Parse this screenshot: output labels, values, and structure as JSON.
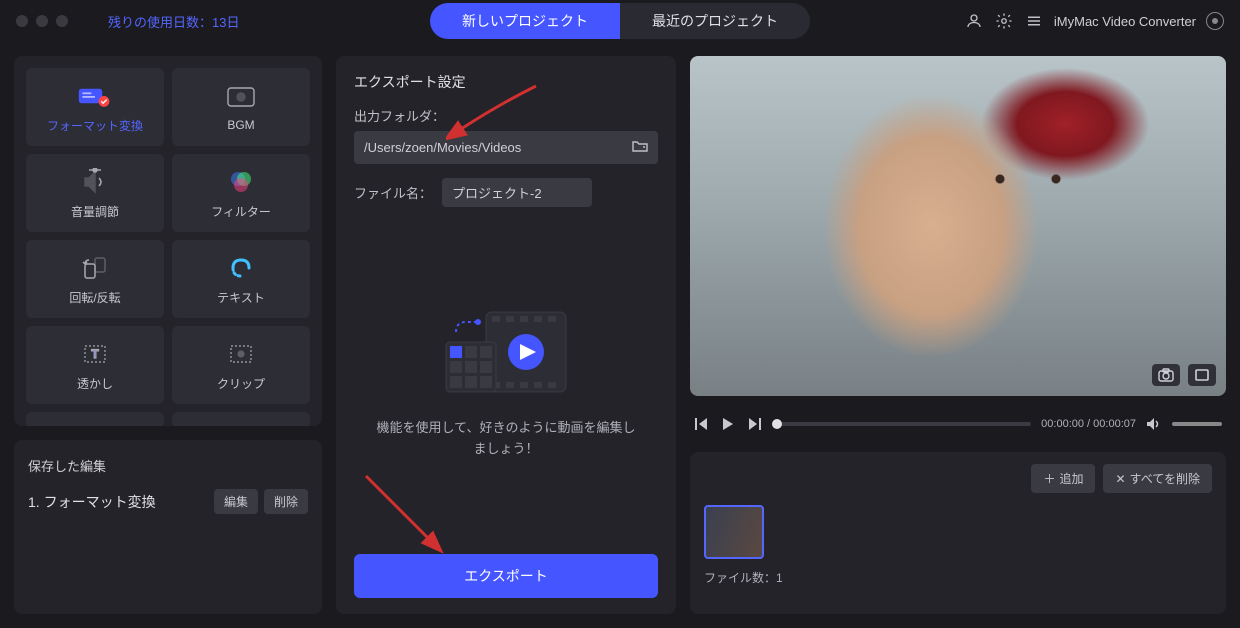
{
  "topbar": {
    "days_left": "残りの使用日数：13日",
    "tab_new": "新しいプロジェクト",
    "tab_recent": "最近のプロジェクト",
    "app_name": "iMyMac Video Converter"
  },
  "tools": {
    "format": "フォーマット変換",
    "bgm": "BGM",
    "volume": "音量調節",
    "filter": "フィルター",
    "rotate": "回転/反転",
    "text": "テキスト",
    "watermark": "透かし",
    "clip": "クリップ"
  },
  "saved": {
    "title": "保存した編集",
    "item1": "1. フォーマット変換",
    "edit": "編集",
    "delete": "削除"
  },
  "export": {
    "title": "エクスポート設定",
    "folder_label": "出力フォルダ：",
    "folder_path": "/Users/zoen/Movies/Videos",
    "file_label": "ファイル名：",
    "file_name": "プロジェクト-2",
    "hint": "機能を使用して、好きのように動画を編集しましょう！",
    "button": "エクスポート"
  },
  "player": {
    "current": "00:00:00",
    "total": "00:00:07"
  },
  "files": {
    "add": "追加",
    "delete_all": "すべてを削除",
    "count_label": "ファイル数：1"
  }
}
